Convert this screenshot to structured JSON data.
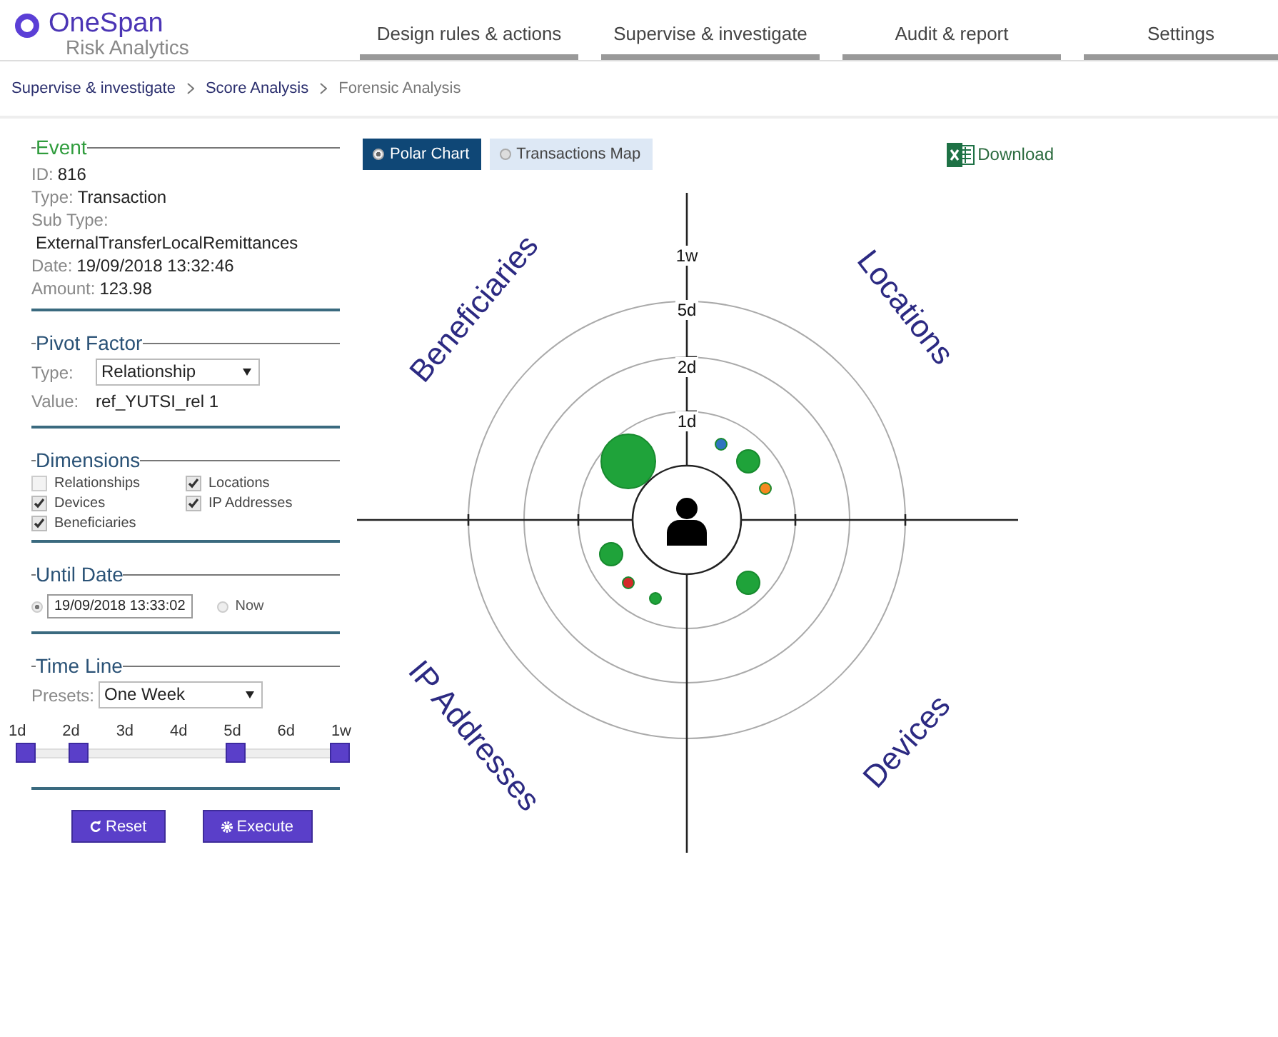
{
  "brand": {
    "name": "OneSpan",
    "product": "Risk Analytics"
  },
  "nav": [
    {
      "label": "Design rules & actions"
    },
    {
      "label": "Supervise & investigate"
    },
    {
      "label": "Audit & report"
    },
    {
      "label": "Settings"
    }
  ],
  "breadcrumb": [
    {
      "label": "Supervise & investigate",
      "kind": "link"
    },
    {
      "label": "Score Analysis",
      "kind": "link"
    },
    {
      "label": "Forensic Analysis",
      "kind": "current"
    }
  ],
  "event": {
    "title": "Event",
    "highlighted": true,
    "fields": [
      {
        "label": "ID:",
        "value": "816"
      },
      {
        "label": "Type:",
        "value": "Transaction"
      },
      {
        "label": "Sub Type:",
        "value": "ExternalTransferLocalRemittances",
        "kind": "below"
      },
      {
        "label": "Date:",
        "value": "19/09/2018 13:32:46"
      },
      {
        "label": "Amount:",
        "value": "123.98"
      }
    ]
  },
  "pivot_factor": {
    "title": "Pivot Factor",
    "highlighted": false,
    "type_label": "Type:",
    "type_value": "Relationship",
    "value_label": "Value:",
    "value": "ref_YUTSI_rel 1"
  },
  "dimensions": {
    "title": "Dimensions",
    "highlighted": false,
    "items": [
      {
        "label": "Relationships",
        "checked": false
      },
      {
        "label": "Locations",
        "checked": true
      },
      {
        "label": "Devices",
        "checked": true
      },
      {
        "label": "IP Addresses",
        "checked": true
      },
      {
        "label": "Beneficiaries",
        "checked": true
      }
    ]
  },
  "until_date": {
    "title": "Until Date",
    "highlighted": false,
    "options": [
      {
        "kind": "date",
        "value": "19/09/2018 13:33:02",
        "selected": true
      },
      {
        "kind": "now",
        "label": "Now",
        "selected": false
      }
    ]
  },
  "time_line": {
    "title": "Time Line",
    "highlighted": false,
    "presets_label": "Presets:",
    "preset": "One Week",
    "ticks": [
      "1d",
      "2d",
      "3d",
      "4d",
      "5d",
      "6d",
      "1w"
    ],
    "handles": [
      {
        "level": 0
      },
      {
        "level": 0.1667
      },
      {
        "level": 0.6667
      },
      {
        "level": 1
      }
    ]
  },
  "buttons": [
    {
      "label": "Reset",
      "kind": "reset"
    },
    {
      "label": "Execute",
      "kind": "execute"
    }
  ],
  "view_tabs": [
    {
      "label": "Polar Chart",
      "selected": true
    },
    {
      "label": "Transactions Map",
      "selected": false
    }
  ],
  "download": {
    "label": "Download"
  },
  "polar": {
    "ring_labels": [
      "1w",
      "5d",
      "2d",
      "1d"
    ],
    "dimension_labels": [
      "Beneficiaries",
      "Locations",
      "IP Addresses",
      "Devices"
    ]
  }
}
